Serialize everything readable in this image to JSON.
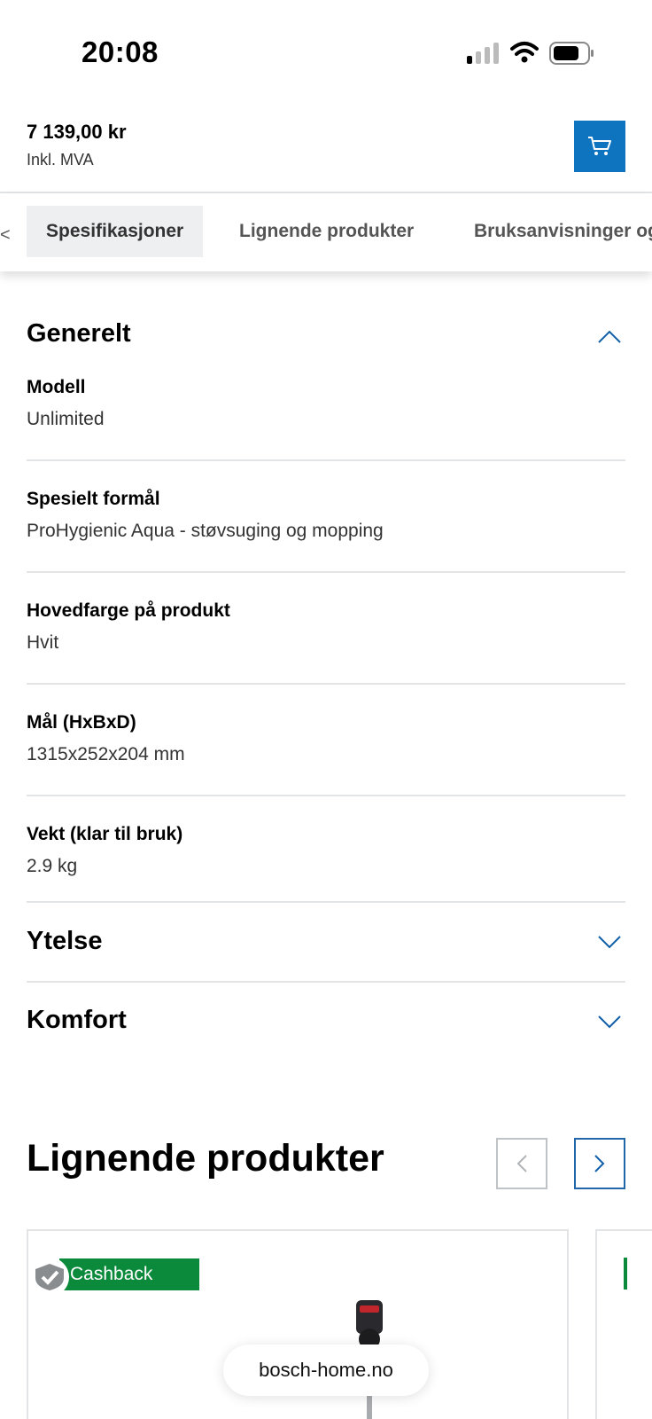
{
  "status_bar": {
    "time": "20:08"
  },
  "header": {
    "price": "7 139,00 kr",
    "vat_note": "Inkl. MVA"
  },
  "tabs": [
    {
      "label": "Spesifikasjoner",
      "active": true
    },
    {
      "label": "Lignende produkter",
      "active": false
    },
    {
      "label": "Bruksanvisninger og dokumenter",
      "active": false
    }
  ],
  "tab_cut_glyph": "<",
  "sections": {
    "generelt": {
      "title": "Generelt",
      "expanded": true
    },
    "ytelse": {
      "title": "Ytelse",
      "expanded": false
    },
    "komfort": {
      "title": "Komfort",
      "expanded": false
    }
  },
  "specs": [
    {
      "label": "Modell",
      "value": "Unlimited"
    },
    {
      "label": "Spesielt formål",
      "value": "ProHygienic Aqua - støvsuging og mopping"
    },
    {
      "label": "Hovedfarge på produkt",
      "value": "Hvit"
    },
    {
      "label": "Mål (HxBxD)",
      "value": "1315x252x204 mm"
    },
    {
      "label": "Vekt (klar til bruk)",
      "value": "2.9 kg"
    }
  ],
  "similar": {
    "title": "Lignende produkter",
    "badge": "Cashback"
  },
  "url_bar": {
    "domain": "bosch-home.no"
  },
  "colors": {
    "accent": "#0f74c0",
    "cashback": "#0c8a3c",
    "divider": "#e2e4e6"
  }
}
